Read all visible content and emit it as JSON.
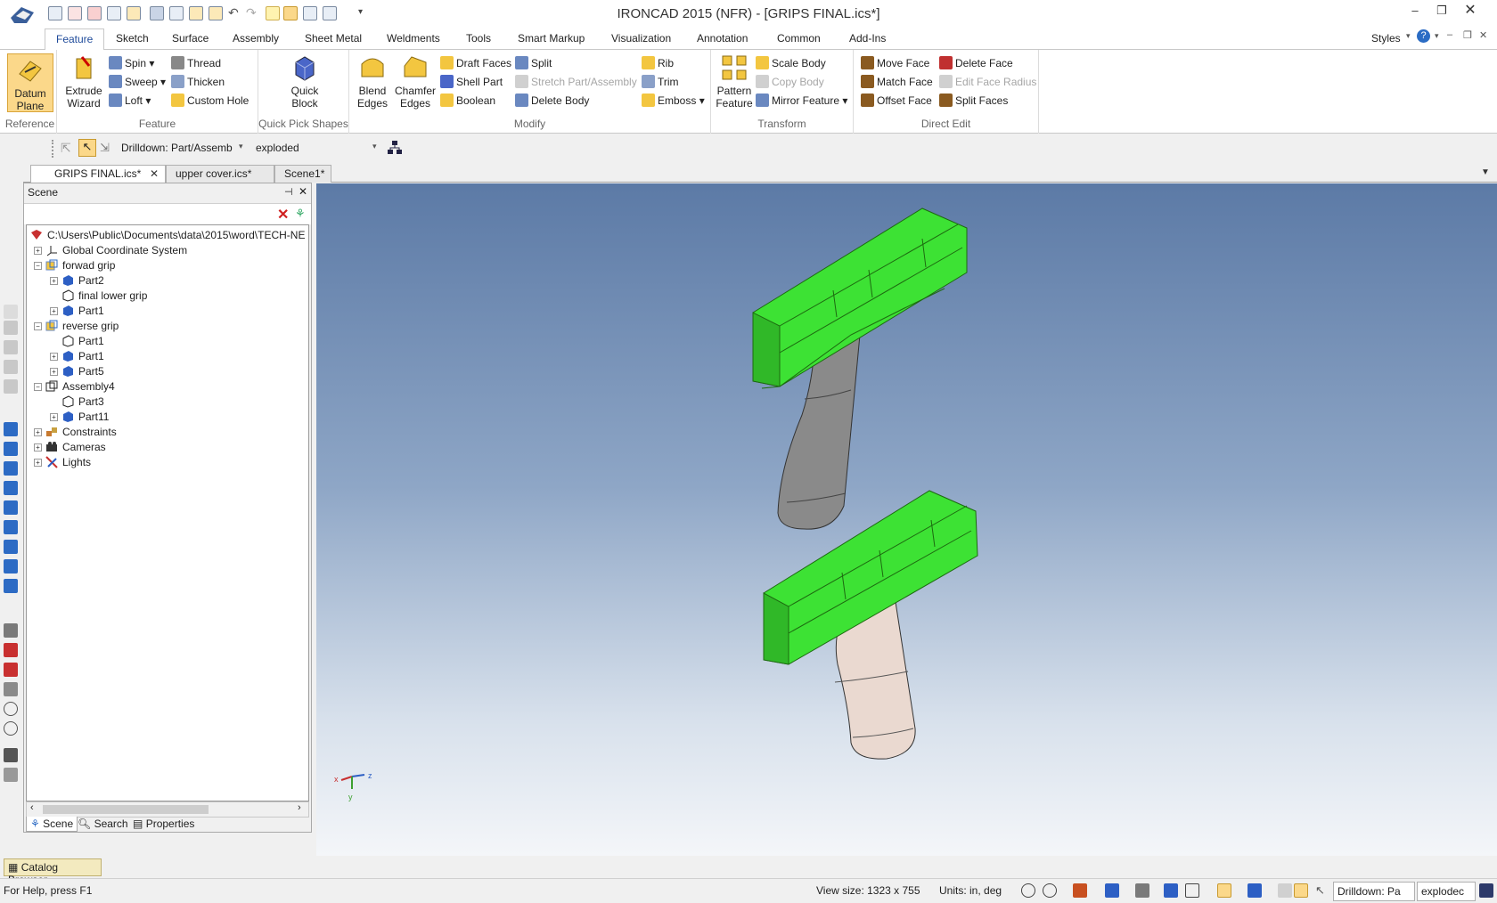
{
  "window": {
    "title": "IRONCAD 2015 (NFR) - [GRIPS FINAL.ics*]"
  },
  "menu_tabs": [
    "Feature",
    "Sketch",
    "Surface",
    "Assembly",
    "Sheet Metal",
    "Weldments",
    "Tools",
    "Smart Markup",
    "Visualization",
    "Annotation",
    "Common",
    "Add-Ins"
  ],
  "menu_right": {
    "styles": "Styles"
  },
  "ribbon": {
    "reference": {
      "label": "Reference",
      "datum_plane": "Datum Plane"
    },
    "feature": {
      "label": "Feature",
      "extrude_wizard": "Extrude Wizard",
      "spin": "Spin",
      "sweep": "Sweep",
      "loft": "Loft",
      "thread": "Thread",
      "thicken": "Thicken",
      "custom_hole": "Custom Hole"
    },
    "quick_pick": {
      "label": "Quick Pick Shapes",
      "quick_block": "Quick Block"
    },
    "modify": {
      "label": "Modify",
      "blend_edges": "Blend Edges",
      "chamfer_edges": "Chamfer Edges",
      "draft_faces": "Draft Faces",
      "shell_part": "Shell Part",
      "boolean": "Boolean",
      "split": "Split",
      "stretch": "Stretch Part/Assembly",
      "delete_body": "Delete Body",
      "rib": "Rib",
      "trim": "Trim",
      "emboss": "Emboss"
    },
    "transform": {
      "label": "Transform",
      "pattern_feature": "Pattern Feature",
      "scale_body": "Scale Body",
      "copy_body": "Copy Body",
      "mirror_feature": "Mirror Feature"
    },
    "direct_edit": {
      "label": "Direct Edit",
      "move_face": "Move Face",
      "match_face": "Match Face",
      "offset_face": "Offset Face",
      "delete_face": "Delete Face",
      "edit_face_radius": "Edit Face Radius",
      "split_faces": "Split Faces"
    }
  },
  "toolbar": {
    "drilldown": "Drilldown: Part/Assemb",
    "config": "exploded"
  },
  "doc_tabs": [
    "GRIPS FINAL.ics*",
    "upper cover.ics*",
    "Scene1*"
  ],
  "scene_panel": {
    "title": "Scene",
    "tree": [
      {
        "label": "C:\\Users\\Public\\Documents\\data\\2015\\word\\TECH-NE",
        "level": 0,
        "icon": "scene-icon",
        "exp": ""
      },
      {
        "label": "Global Coordinate System",
        "level": 1,
        "icon": "axes-icon",
        "exp": "+"
      },
      {
        "label": "forwad grip",
        "level": 1,
        "icon": "assembly-icon",
        "exp": "-"
      },
      {
        "label": "Part2",
        "level": 2,
        "icon": "part-icon",
        "exp": "+"
      },
      {
        "label": "final lower grip",
        "level": 2,
        "icon": "part-outline-icon",
        "exp": ""
      },
      {
        "label": "Part1",
        "level": 2,
        "icon": "part-icon",
        "exp": "+"
      },
      {
        "label": "reverse grip",
        "level": 1,
        "icon": "assembly-icon",
        "exp": "-"
      },
      {
        "label": "Part1",
        "level": 2,
        "icon": "part-outline-icon",
        "exp": ""
      },
      {
        "label": "Part1",
        "level": 2,
        "icon": "part-icon",
        "exp": "+"
      },
      {
        "label": "Part5",
        "level": 2,
        "icon": "part-icon",
        "exp": "+"
      },
      {
        "label": "Assembly4",
        "level": 1,
        "icon": "assembly-outline-icon",
        "exp": "-"
      },
      {
        "label": "Part3",
        "level": 2,
        "icon": "part-outline-icon",
        "exp": ""
      },
      {
        "label": "Part11",
        "level": 2,
        "icon": "part-icon",
        "exp": "+"
      },
      {
        "label": "Constraints",
        "level": 1,
        "icon": "constraints-icon",
        "exp": "+"
      },
      {
        "label": "Cameras",
        "level": 1,
        "icon": "camera-icon",
        "exp": "+"
      },
      {
        "label": "Lights",
        "level": 1,
        "icon": "light-icon",
        "exp": "+"
      }
    ],
    "footer_tabs": [
      "Scene",
      "Search",
      "Properties"
    ]
  },
  "catalog_browser": "Catalog Browser",
  "status": {
    "help": "For Help, press F1",
    "view_size": "View size: 1323 x 755",
    "units": "Units: in, deg",
    "drilldown": "Drilldown: Pa",
    "config": "explodec"
  },
  "colors": {
    "green_part": "#3de234",
    "accent": "#1e4a9a",
    "selected_icon": "#f5c842"
  }
}
